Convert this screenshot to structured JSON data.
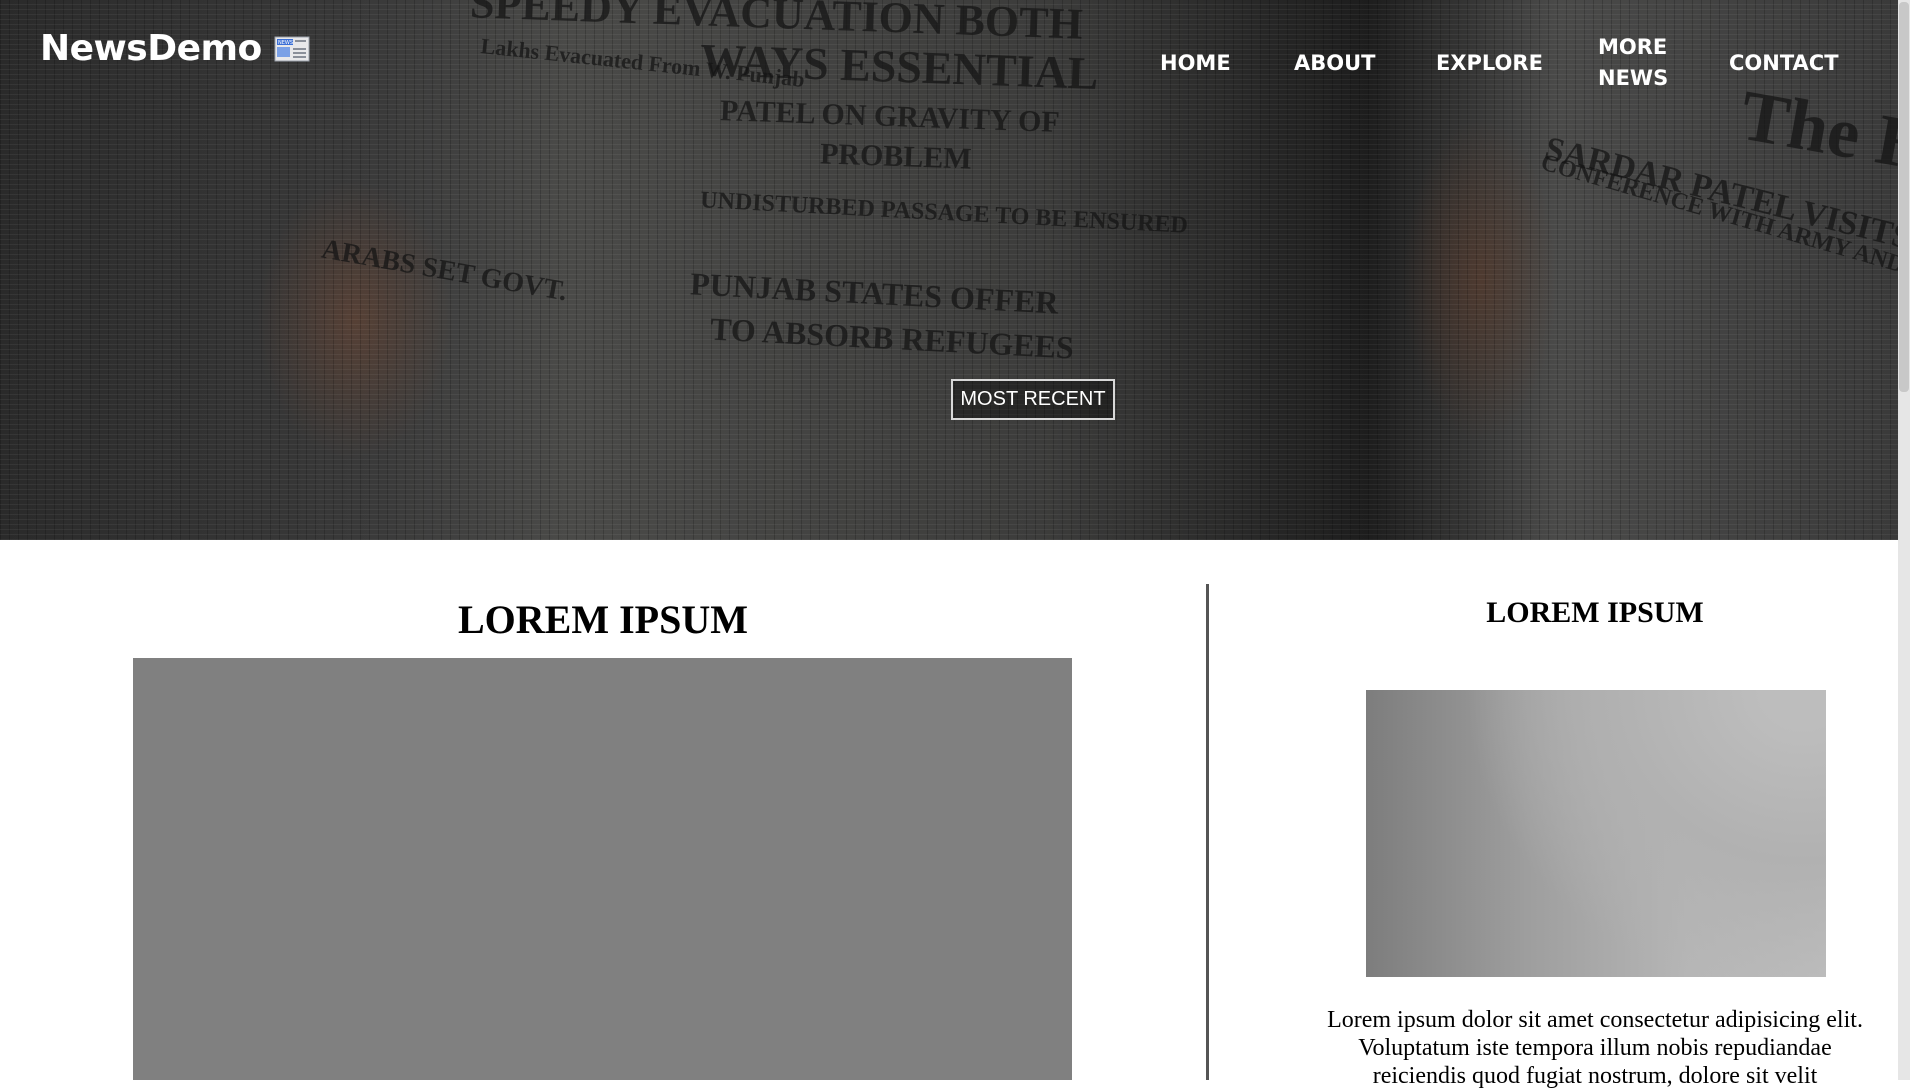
{
  "brand": {
    "name": "NewsDemo",
    "icon_text": "NEWS"
  },
  "nav": {
    "items": [
      "HOME",
      "ABOUT",
      "EXPLORE",
      "MORE NEWS",
      "CONTACT"
    ]
  },
  "hero": {
    "button_label": "MOST RECENT",
    "newspaper_text": [
      "SPEEDY EVACUATION BOTH",
      "WAYS ESSENTIAL",
      "PATEL ON GRAVITY OF",
      "PROBLEM",
      "UNDISTURBED PASSAGE TO BE ENSURED",
      "PUNJAB STATES OFFER",
      "TO ABSORB REFUGEES",
      "SARDAR PATEL VISITS",
      "CONFERENCE WITH ARMY AND CIVIL OFFICIALS",
      "The H",
      "ARABS SET GOVT.",
      "Lakhs Evacuated From W. Punjab"
    ]
  },
  "main": {
    "title": "LOREM IPSUM"
  },
  "sidebar": {
    "title": "LOREM IPSUM",
    "text": "Lorem ipsum dolor sit amet consectetur adipisicing elit. Voluptatum iste tempora illum nobis repudiandae reiciendis quod fugiat nostrum, dolore sit velit"
  },
  "colors": {
    "hero_overlay": "#2b2b2b",
    "placeholder_gray": "#808080",
    "divider": "#555555"
  }
}
